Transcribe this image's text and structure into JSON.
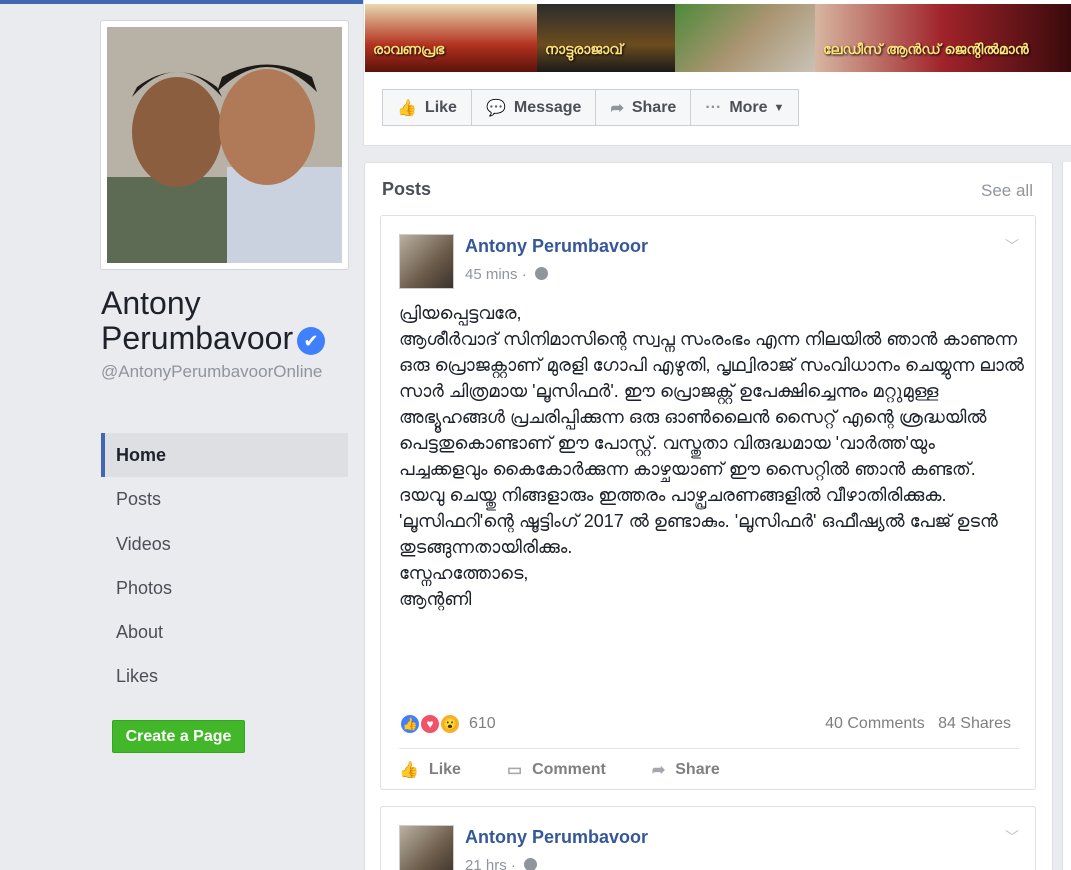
{
  "page": {
    "name": "Antony Perumbavoor",
    "handle": "@AntonyPerumbavoorOnline",
    "verified_badge": "✔"
  },
  "cover": {
    "segments": [
      "രാവണപ്രഭ",
      "നാട്ടുരാജാവ്",
      "",
      "ലേഡീസ് ആൻഡ് ജെന്റിൽമാൻ"
    ]
  },
  "actions": {
    "like": "Like",
    "message": "Message",
    "share": "Share",
    "more": "More"
  },
  "nav": {
    "items": [
      "Home",
      "Posts",
      "Videos",
      "Photos",
      "About",
      "Likes"
    ],
    "active": "Home"
  },
  "create_page": "Create a Page",
  "posts_section": {
    "title": "Posts",
    "see_all": "See all"
  },
  "posts": [
    {
      "author": "Antony Perumbavoor",
      "time": "45 mins · ",
      "text": "പ്രിയപ്പെട്ടവരേ,\nആശീർവാദ് സിനിമാസിന്റെ സ്വപ്ന സംരംഭം എന്ന നിലയിൽ ഞാൻ കാണുന്ന ഒരു പ്രൊജക്റ്റാണ് മുരളി ഗോപി എഴുതി, പൃഥ്വിരാജ് സംവിധാനം ചെയ്യുന്ന ലാൽ സാർ ചിത്രമായ 'ലൂസിഫർ'. ഈ പ്രൊജക്റ്റ് ഉപേക്ഷിച്ചെന്നും മറ്റുമുള്ള അഭ്യൂഹങ്ങൾ പ്രചരിപ്പിക്കുന്ന ഒരു ഓൺലൈൻ സൈറ്റ് എന്റെ ശ്രദ്ധയിൽ പെട്ടതുകൊണ്ടാണ് ഈ പോസ്റ്റ്. വസ്തുതാ വിരുദ്ധമായ 'വാർത്ത'യും പച്ചക്കളവും കൈകോർക്കുന്ന കാഴ്ചയാണ് ഈ സൈറ്റിൽ ഞാൻ കണ്ടത്. ദയവു ചെയ്തു നിങ്ങളാരും ഇത്തരം പാഴ്പ്രചരണങ്ങളിൽ വീഴാതിരിക്കുക. 'ലൂസിഫറി'ന്റെ ഷൂട്ടിംഗ് 2017 ൽ ഉണ്ടാകും. 'ലൂസിഫർ' ഒഫീഷ്യൽ പേജ് ഉടൻ തുടങ്ങുന്നതായിരിക്കും.\nസ്നേഹത്തോടെ,\nആന്റണി",
      "reaction_count": "610",
      "comments": "40 Comments",
      "shares": "84 Shares",
      "like_label": "Like",
      "comment_label": "Comment",
      "share_label": "Share"
    },
    {
      "author": "Antony Perumbavoor",
      "time": "21 hrs · "
    }
  ]
}
